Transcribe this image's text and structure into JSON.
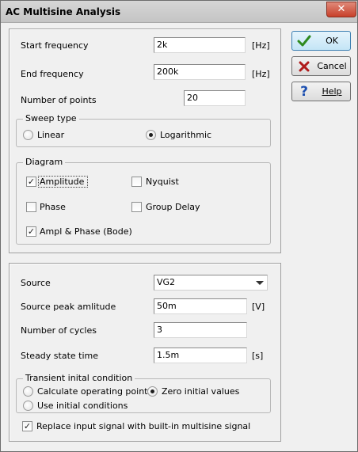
{
  "window": {
    "title": "AC Multisine Analysis",
    "close_glyph": "✕"
  },
  "frequency": {
    "start_label": "Start frequency",
    "start_value": "2k",
    "start_unit": "[Hz]",
    "end_label": "End frequency",
    "end_value": "200k",
    "end_unit": "[Hz]",
    "points_label": "Number of points",
    "points_value": "20"
  },
  "sweep": {
    "title": "Sweep type",
    "linear_label": "Linear",
    "linear_selected": false,
    "log_label": "Logarithmic",
    "log_selected": true
  },
  "diagram": {
    "title": "Diagram",
    "amplitude_label": "Amplitude",
    "amplitude_checked": true,
    "nyquist_label": "Nyquist",
    "nyquist_checked": false,
    "phase_label": "Phase",
    "phase_checked": false,
    "group_delay_label": "Group Delay",
    "group_delay_checked": false,
    "bode_label": "Ampl & Phase (Bode)",
    "bode_checked": true
  },
  "buttons": {
    "ok": "OK",
    "cancel": "Cancel",
    "help": "Help"
  },
  "source": {
    "source_label": "Source",
    "source_value": "VG2",
    "peak_label": "Source peak amlitude",
    "peak_value": "50m",
    "peak_unit": "[V]",
    "cycles_label": "Number of cycles",
    "cycles_value": "3",
    "steady_label": "Steady state time",
    "steady_value": "1.5m",
    "steady_unit": "[s]"
  },
  "transient": {
    "title": "Transient inital condition",
    "calc_label": "Calculate operating point",
    "calc_selected": false,
    "zero_label": "Zero initial values",
    "zero_selected": true,
    "use_label": "Use initial conditions",
    "use_selected": false
  },
  "replace": {
    "label": "Replace input signal with built-in multisine signal",
    "checked": true
  },
  "colors": {
    "accent_ok": "#2f8a1f",
    "accent_cancel": "#b01c1c",
    "accent_help": "#1c4fb0"
  }
}
